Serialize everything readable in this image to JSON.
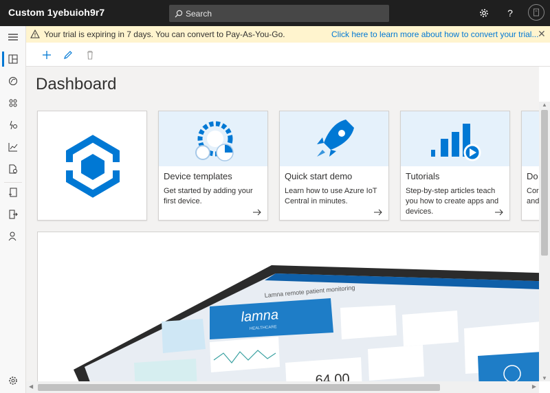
{
  "app": {
    "title": "Custom 1yebuioh9r7"
  },
  "search": {
    "placeholder": "Search"
  },
  "topbar_icons": [
    "gear-icon",
    "help-icon",
    "account-icon"
  ],
  "banner": {
    "message": "Your trial is expiring in 7 days. You can convert to Pay-As-You-Go.",
    "link": "Click here to learn more about how to convert your trial...",
    "icon": "warning-icon"
  },
  "toolbar": {
    "buttons": [
      "add-icon",
      "edit-icon",
      "delete-icon"
    ]
  },
  "nav": {
    "items": [
      "dashboard-icon",
      "devices-icon",
      "device-groups-icon",
      "rules-icon",
      "analytics-icon",
      "jobs-icon",
      "device-templates-icon",
      "data-export-icon",
      "administration-icon"
    ],
    "bottom": "settings-icon"
  },
  "page": {
    "title": "Dashboard"
  },
  "tiles": [
    {
      "title": "Device templates",
      "desc": "Get started by adding your first device."
    },
    {
      "title": "Quick start demo",
      "desc": "Learn how to use Azure IoT Central in minutes."
    },
    {
      "title": "Tutorials",
      "desc": "Step-by-step articles teach you how to create apps and devices."
    },
    {
      "title": "Do",
      "desc_lines": [
        "Cor",
        "and"
      ]
    }
  ],
  "hero": {
    "screen_title": "Lamna remote patient monitoring",
    "brand": "lamna",
    "brand_sub": "HEALTHCARE",
    "big_value": "64.00"
  },
  "colors": {
    "accent": "#0078d4",
    "banner_bg": "#fff4ce",
    "topbar": "#1f1f1f"
  }
}
